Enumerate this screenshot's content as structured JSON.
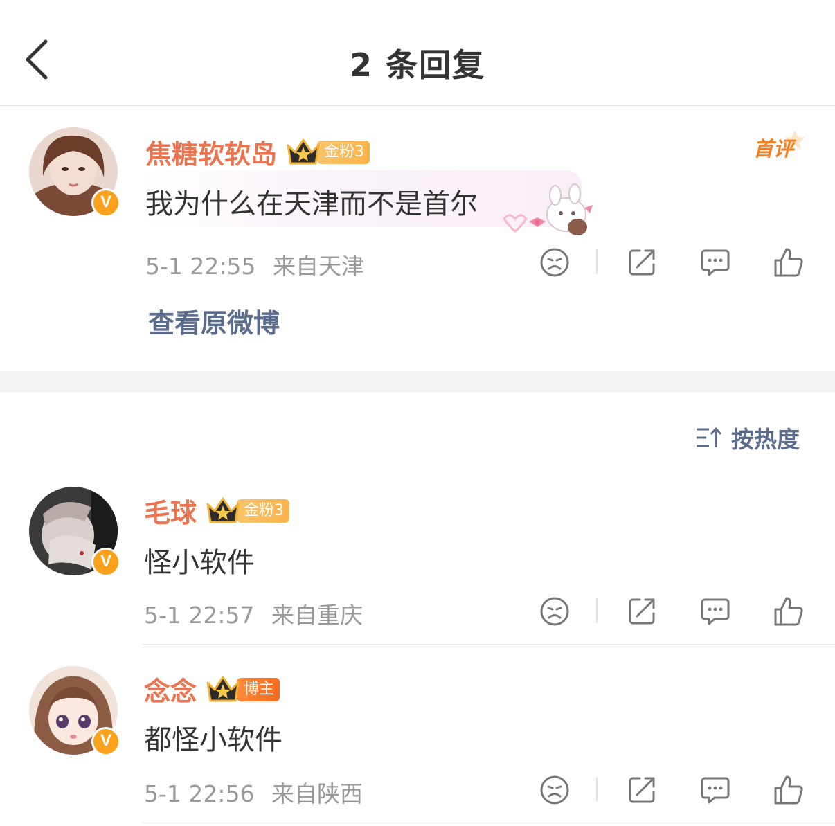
{
  "header": {
    "title": "2 条回复"
  },
  "original_comment": {
    "username": "焦糖软软岛",
    "badge_label": "金粉3",
    "text": "我为什么在天津而不是首尔",
    "time": "5-1 22:55",
    "location": "来自天津",
    "first_tag": "首评",
    "view_original": "查看原微博"
  },
  "sort": {
    "label": "按热度"
  },
  "replies": [
    {
      "username": "毛球",
      "badge_label": "金粉3",
      "text": "怪小软件",
      "time": "5-1 22:57",
      "location": "来自重庆"
    },
    {
      "username": "念念",
      "badge_label": "博主",
      "text": "都怪小软件",
      "time": "5-1 22:56",
      "location": "来自陕西"
    }
  ],
  "colors": {
    "username": "#eb7350",
    "link": "#5a6b8c",
    "meta": "#999999",
    "fan_badge": "#fbb34a",
    "host_badge": "#f26b1d",
    "verified": "#f9a11b"
  },
  "icons": [
    "back-arrow-icon",
    "sad-face-icon",
    "share-icon",
    "comment-icon",
    "like-icon",
    "sort-icon",
    "crown-icon",
    "verified-icon"
  ]
}
